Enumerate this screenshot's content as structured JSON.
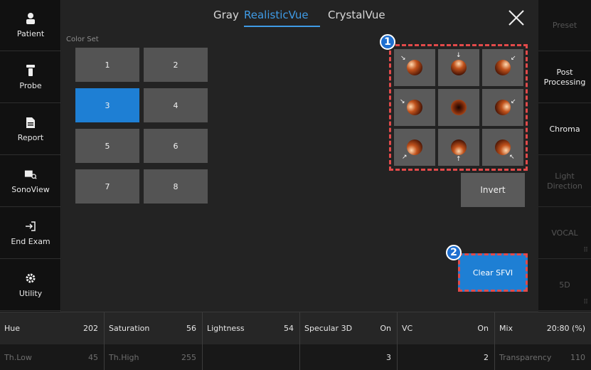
{
  "left_menu": [
    {
      "label": "Patient",
      "icon": "person-icon"
    },
    {
      "label": "Probe",
      "icon": "probe-icon"
    },
    {
      "label": "Report",
      "icon": "document-icon"
    },
    {
      "label": "SonoView",
      "icon": "image-search-icon"
    },
    {
      "label": "End Exam",
      "icon": "exit-icon"
    },
    {
      "label": "Utility",
      "icon": "gear-icon"
    }
  ],
  "tabs": [
    {
      "label": "Gray",
      "active": false
    },
    {
      "label": "RealisticVue",
      "active": true
    },
    {
      "label": "CrystalVue",
      "active": false
    }
  ],
  "color_set": {
    "label": "Color Set",
    "buttons": [
      "1",
      "2",
      "3",
      "4",
      "5",
      "6",
      "7",
      "8"
    ],
    "selected": "3"
  },
  "light_direction_grid": {
    "badge": "1",
    "cells": [
      "top-left",
      "top",
      "top-right",
      "left",
      "center",
      "right",
      "bottom-left",
      "bottom",
      "bottom-right"
    ]
  },
  "invert_label": "Invert",
  "clear_sfvi": {
    "badge": "2",
    "label": "Clear SFVI"
  },
  "right_menu": [
    {
      "label": "Preset",
      "enabled": false
    },
    {
      "label": "Post Processing",
      "enabled": true
    },
    {
      "label": "Chroma",
      "enabled": true
    },
    {
      "label": "Light Direction",
      "enabled": false
    },
    {
      "label": "VOCAL",
      "enabled": false
    },
    {
      "label": "5D",
      "enabled": false
    }
  ],
  "params_row1": [
    {
      "label": "Hue",
      "value": "202"
    },
    {
      "label": "Saturation",
      "value": "56"
    },
    {
      "label": "Lightness",
      "value": "54"
    },
    {
      "label": "Specular 3D",
      "value": "On"
    },
    {
      "label": "VC",
      "value": "On"
    },
    {
      "label": "Mix",
      "value": "20:80 (%)"
    }
  ],
  "params_row2": [
    {
      "label": "Th.Low",
      "value": "45"
    },
    {
      "label": "Th.High",
      "value": "255"
    },
    {
      "label": "",
      "value": ""
    },
    {
      "label": "",
      "value": "3"
    },
    {
      "label": "",
      "value": "2"
    },
    {
      "label": "Transparency",
      "value": "110"
    }
  ],
  "colors": {
    "accent": "#1e7fd4",
    "highlight_border": "#e24a4a",
    "tab_active": "#3f9be6"
  }
}
